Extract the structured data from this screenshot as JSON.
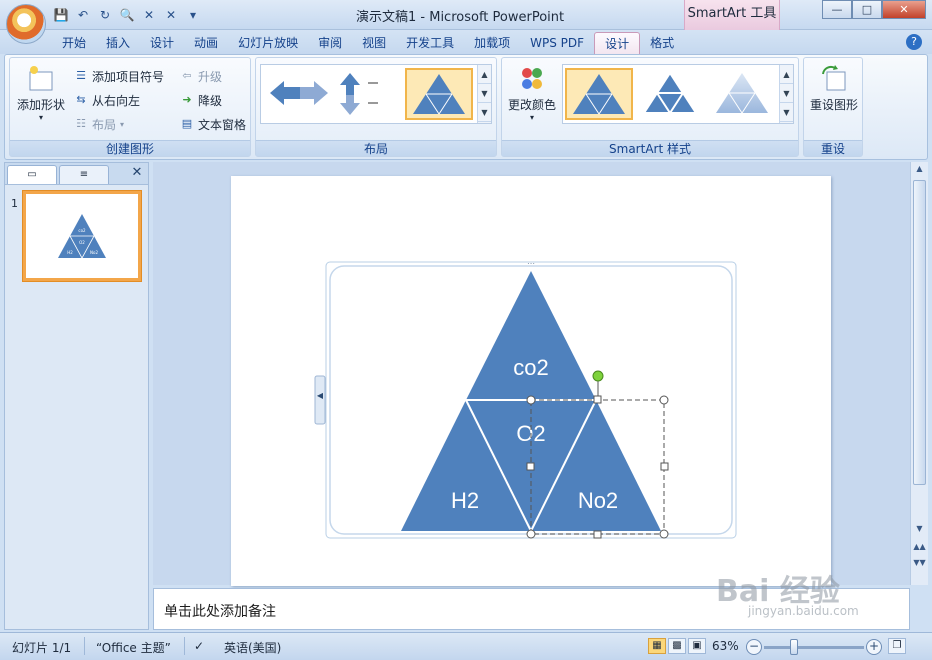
{
  "titlebar": {
    "title": "演示文稿1 - Microsoft PowerPoint",
    "context_title": "SmartArt 工具",
    "qat_icons": [
      "save-icon",
      "undo-icon",
      "redo-icon",
      "print-preview-icon",
      "close-doc-icon",
      "close-doc-icon",
      "customize-qat-icon"
    ]
  },
  "tabs": [
    {
      "label": "开始"
    },
    {
      "label": "插入"
    },
    {
      "label": "设计"
    },
    {
      "label": "动画"
    },
    {
      "label": "幻灯片放映"
    },
    {
      "label": "审阅"
    },
    {
      "label": "视图"
    },
    {
      "label": "开发工具"
    },
    {
      "label": "加载项"
    },
    {
      "label": "WPS PDF"
    },
    {
      "label": "设计"
    },
    {
      "label": "格式"
    }
  ],
  "active_tab_index": 10,
  "ribbon": {
    "create_graphic": {
      "label": "创建图形",
      "add_shape": "添加形状",
      "add_bullet": "添加项目符号",
      "right_to_left": "从右向左",
      "layout": "布局",
      "promote": "升级",
      "demote": "降级",
      "text_pane": "文本窗格"
    },
    "layouts": {
      "label": "布局"
    },
    "smartart_styles": {
      "label": "SmartArt 样式",
      "change_colors": "更改颜色"
    },
    "reset": {
      "label": "重设",
      "reset_graphic": "重设图形"
    }
  },
  "slide_panel": {
    "slide_number": "1",
    "thumb_labels": [
      "co2",
      "O2",
      "H2",
      "No2"
    ]
  },
  "diagram": {
    "shapes": [
      "co2",
      "O2",
      "H2",
      "No2"
    ],
    "fill_color": "#4f81bd"
  },
  "notes": {
    "placeholder": "单击此处添加备注"
  },
  "status": {
    "slide_info": "幻灯片 1/1",
    "theme": "“Office 主题”",
    "language": "英语(美国)",
    "zoom": "63%"
  },
  "watermark": {
    "text": "Bai 经验",
    "sub": "jingyan.baidu.com"
  }
}
